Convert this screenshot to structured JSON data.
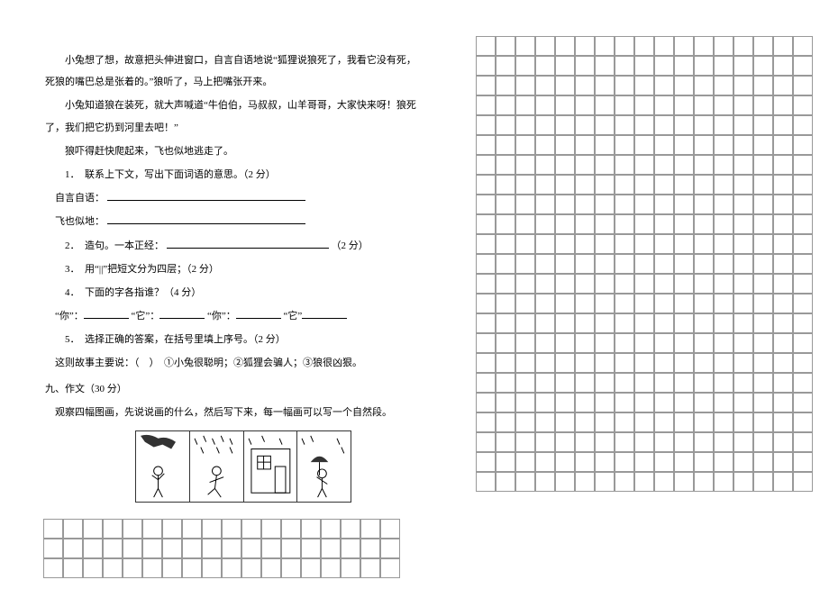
{
  "passage": {
    "p1": "小兔想了想，故意把头伸进窗口，自言自语地说“狐狸说狼死了，我看它没有死，死狼的嘴巴总是张着的。”狼听了，马上把嘴张开来。",
    "p2": "小兔知道狼在装死，就大声喊道“牛伯伯，马叔叔，山羊哥哥，大家快来呀！狼死了，我们把它扔到河里去吧！”",
    "p3": "狼吓得赶快爬起来，飞也似地逃走了。"
  },
  "questions": {
    "q1": {
      "prompt": "1．　联系上下文，写出下面词语的意思。（2 分）",
      "sub1": "自言自语：",
      "sub2": "飞也似地："
    },
    "q2": {
      "prompt": "2．　造句。一本正经：",
      "points": "（2 分）"
    },
    "q3": "3．　用“||”把短文分为四层；（2 分）",
    "q4": {
      "prompt": "4．　下面的字各指谁？（4 分）",
      "labels": [
        "“你”：",
        "“它”：",
        "“你”：",
        "“它”"
      ]
    },
    "q5": {
      "prompt": "5．　选择正确的答案，在括号里填上序号。（2 分）",
      "detail": "这则故事主要说：（　）　①小兔很聪明；②狐狸会骗人；③狼很凶狠。"
    }
  },
  "section9": {
    "title": "九、作文（30 分）",
    "instruction": "观察四幅图画，先说说画的什么，然后写下来，每一幅画可以写一个自然段。"
  },
  "comic": {
    "alt": "四格连环画：男孩与下雨场景"
  }
}
